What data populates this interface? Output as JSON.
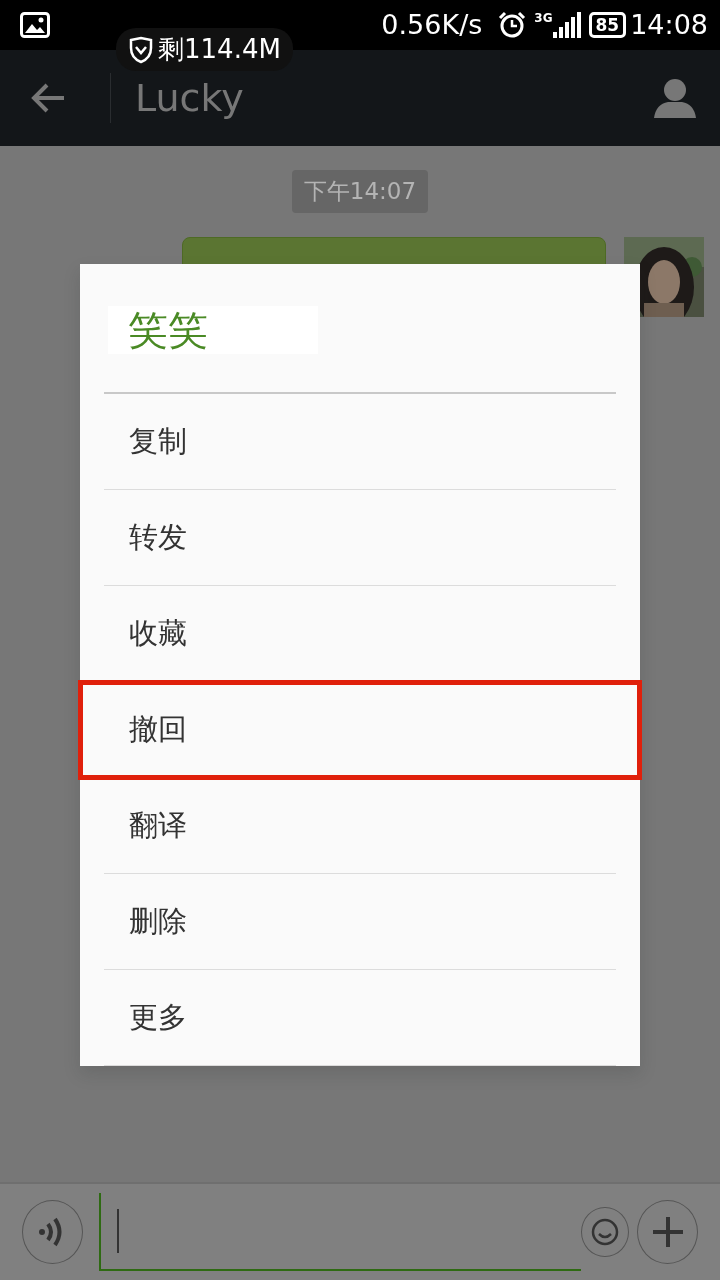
{
  "status_bar": {
    "speed": "0.56K/s",
    "network": "3G",
    "battery": "85",
    "time": "14:08",
    "data_left": "剩114.4M"
  },
  "header": {
    "title": "Lucky"
  },
  "chat": {
    "timestamp": "下午14:07"
  },
  "dialog": {
    "title": "笑笑",
    "items": [
      {
        "label": "复制",
        "highlighted": false
      },
      {
        "label": "转发",
        "highlighted": false
      },
      {
        "label": "收藏",
        "highlighted": false
      },
      {
        "label": "撤回",
        "highlighted": true
      },
      {
        "label": "翻译",
        "highlighted": false
      },
      {
        "label": "删除",
        "highlighted": false
      },
      {
        "label": "更多",
        "highlighted": false
      }
    ]
  }
}
